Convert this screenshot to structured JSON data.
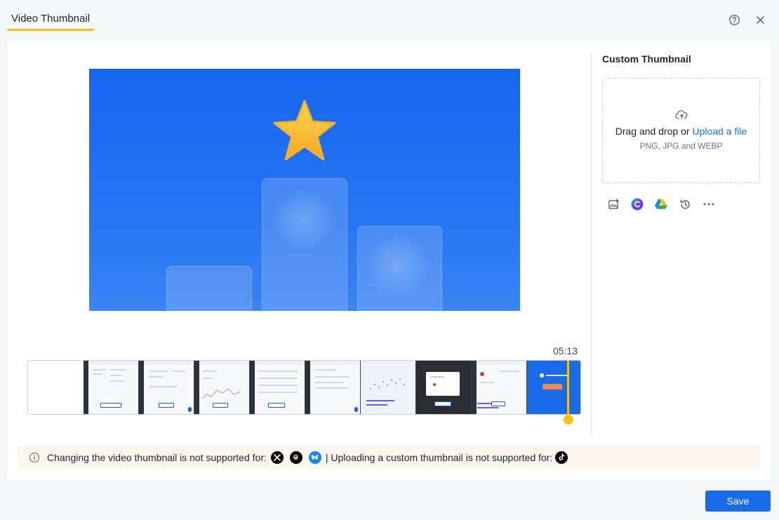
{
  "header": {
    "tab_label": "Video Thumbnail",
    "help_icon": "question-circle-icon",
    "close_icon": "close-icon"
  },
  "player": {
    "duration": "05:13"
  },
  "custom_thumbnail": {
    "title": "Custom Thumbnail",
    "upload_icon": "cloud-upload-icon",
    "drop_text": "Drag and drop or",
    "upload_link": "Upload a file",
    "formats": "PNG, JPG and WEBP",
    "tools": [
      "image-add-icon",
      "canva-icon",
      "google-drive-icon",
      "history-icon",
      "more-icon"
    ]
  },
  "notice": {
    "info_icon": "info-icon",
    "text_1": "Changing the video thumbnail is not supported for:",
    "unsupported_change": [
      "x-icon",
      "threads-icon",
      "bluesky-icon"
    ],
    "text_2": "| Uploading a custom thumbnail is not supported for:",
    "unsupported_upload": [
      "tiktok-icon"
    ]
  },
  "footer": {
    "save_label": "Save"
  },
  "colors": {
    "accent": "#f6c21a",
    "primary": "#1a6be8",
    "link": "#1a73e8",
    "notice_bg": "#fdf6ec"
  }
}
